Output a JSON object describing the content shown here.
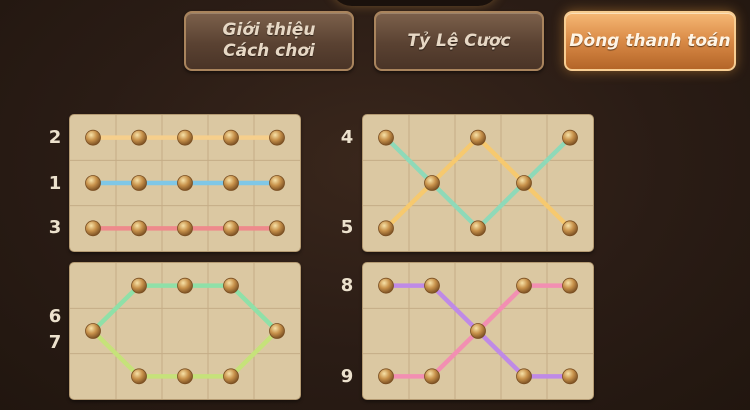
{
  "tabs": [
    {
      "label": "Giới thiệu\nCách chơi",
      "active": false
    },
    {
      "label": "Tỷ Lệ Cược",
      "active": false
    },
    {
      "label": "Dòng thanh toán",
      "active": true
    }
  ],
  "paylines": [
    {
      "id": "payline-2",
      "label": "2",
      "rows": [
        0,
        0,
        0,
        0,
        0
      ],
      "color": "#f6cf8c"
    },
    {
      "id": "payline-1",
      "label": "1",
      "rows": [
        1,
        1,
        1,
        1,
        1
      ],
      "color": "#7fc7e6"
    },
    {
      "id": "payline-3",
      "label": "3",
      "rows": [
        2,
        2,
        2,
        2,
        2
      ],
      "color": "#ee8a8c"
    },
    {
      "id": "payline-4",
      "label": "4",
      "rows": [
        0,
        1,
        2,
        1,
        0
      ],
      "color": "#8fd9b8"
    },
    {
      "id": "payline-5",
      "label": "5",
      "rows": [
        2,
        1,
        0,
        1,
        2
      ],
      "color": "#f6c96f"
    },
    {
      "id": "payline-6",
      "label": "6",
      "rows": [
        1,
        0,
        0,
        0,
        1
      ],
      "color": "#8fe0a8"
    },
    {
      "id": "payline-7",
      "label": "7",
      "rows": [
        1,
        2,
        2,
        2,
        1
      ],
      "color": "#c6e27a"
    },
    {
      "id": "payline-8",
      "label": "8",
      "rows": [
        0,
        0,
        1,
        2,
        2
      ],
      "color": "#bf8ae6"
    },
    {
      "id": "payline-9",
      "label": "9",
      "rows": [
        2,
        2,
        1,
        0,
        0
      ],
      "color": "#f28fb2"
    }
  ],
  "colors": {
    "grid": "#c4ad86",
    "bead": "#c8924b",
    "bead_highlight": "#f7e2a8",
    "bead_shadow": "#7a4f22"
  }
}
